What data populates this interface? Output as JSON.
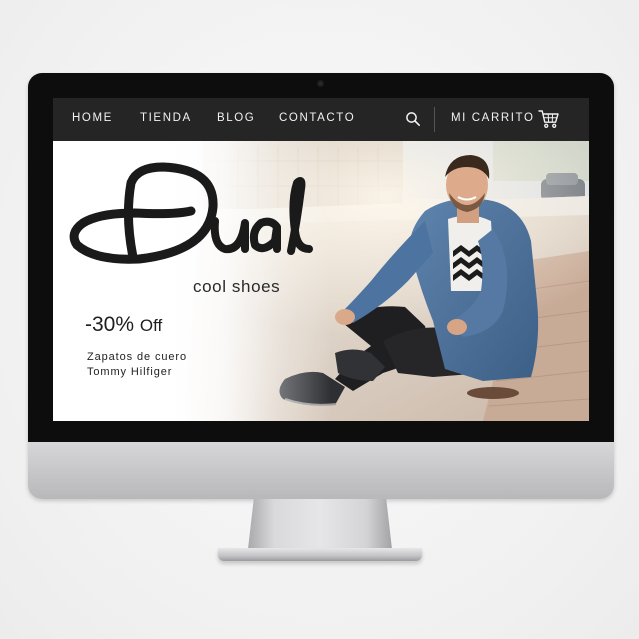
{
  "nav": {
    "items": [
      {
        "label": "HOME"
      },
      {
        "label": "TIENDA"
      },
      {
        "label": "BLOG"
      },
      {
        "label": "CONTACTO"
      }
    ],
    "search_icon": "search-icon",
    "cart_label": "MI CARRITO",
    "cart_icon": "shopping-cart-icon"
  },
  "hero": {
    "brand": "Dual",
    "tagline": "cool shoes",
    "discount": "-30%",
    "discount_suffix": "Off",
    "product_lines": [
      "Zapatos de cuero",
      "Tommy Hilfiger"
    ]
  },
  "colors": {
    "nav_background": "#252525",
    "nav_text": "#f2f2f2",
    "logo": "#1a1a1a",
    "bezel": "#0d0d0d"
  }
}
